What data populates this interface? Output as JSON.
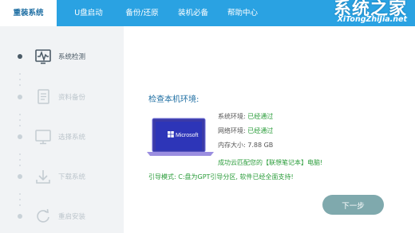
{
  "nav": {
    "items": [
      {
        "label": "重装系统",
        "active": true
      },
      {
        "label": "U盘启动",
        "active": false
      },
      {
        "label": "备份/还原",
        "active": false
      },
      {
        "label": "装机必备",
        "active": false
      },
      {
        "label": "帮助中心",
        "active": false
      }
    ]
  },
  "brand": {
    "title": "系统之家",
    "url": "XiTongZhiJia.net"
  },
  "sidebar": {
    "steps": [
      {
        "label": "系统检测",
        "icon": "waveform-monitor-icon",
        "active": true
      },
      {
        "label": "资料备份",
        "icon": "document-icon",
        "active": false
      },
      {
        "label": "选择系统",
        "icon": "monitor-icon",
        "active": false
      },
      {
        "label": "下载系统",
        "icon": "download-icon",
        "active": false
      },
      {
        "label": "重启安装",
        "icon": "restart-icon",
        "active": false
      }
    ]
  },
  "main": {
    "title": "检查本机环境:",
    "laptop_screen_text": "Microsoft",
    "info": [
      {
        "key": "系统环境:",
        "value": "已经通过",
        "status": "pass"
      },
      {
        "key": "网络环境:",
        "value": "已经通过",
        "status": "pass"
      },
      {
        "key": "内存大小:",
        "value": "7.88 GB",
        "status": "neutral"
      }
    ],
    "match_text": "成功云匹配您的【联想笔记本】电脑!",
    "boot_text": "引导模式: C:盘为GPT引导分区, 软件已经全面支持!",
    "next_button": "下一步"
  },
  "colors": {
    "topbar": "#2aa2e2",
    "pass_green": "#2a9c3a",
    "title_blue": "#1f6fa3",
    "button": "#7fa9ad"
  }
}
